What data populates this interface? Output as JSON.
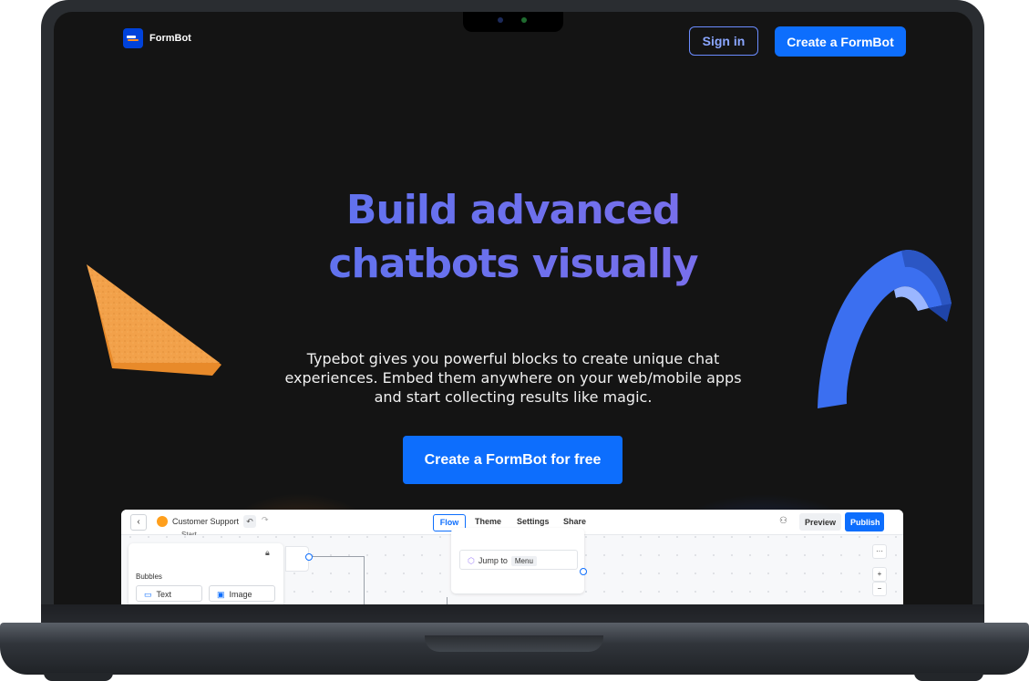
{
  "nav": {
    "logo_text": "FormBot",
    "sign_in": "Sign in",
    "create": "Create a FormBot"
  },
  "hero": {
    "title_line1": "Build advanced",
    "title_line2": "chatbots visually",
    "description": "Typebot gives you powerful blocks to create unique chat experiences. Embed them anywhere on your web/mobile apps and start collecting results like magic.",
    "cta": "Create a FormBot for free"
  },
  "app_preview": {
    "bot_name": "Customer Support",
    "tabs": [
      "Flow",
      "Theme",
      "Settings",
      "Share"
    ],
    "active_tab": "Flow",
    "preview": "Preview",
    "publish": "Publish",
    "start_label": "Start",
    "sidebar_section": "Bubbles",
    "blocks": [
      "Text",
      "Image"
    ],
    "jump_to": "Jump to",
    "jump_target": "Menu",
    "more": "···",
    "zoom_in": "+",
    "zoom_out": "−"
  },
  "colors": {
    "accent": "#0d6efd",
    "screen_bg": "#141414",
    "title_gradient_start": "#4f74f0",
    "title_gradient_end": "#8a6dea"
  }
}
